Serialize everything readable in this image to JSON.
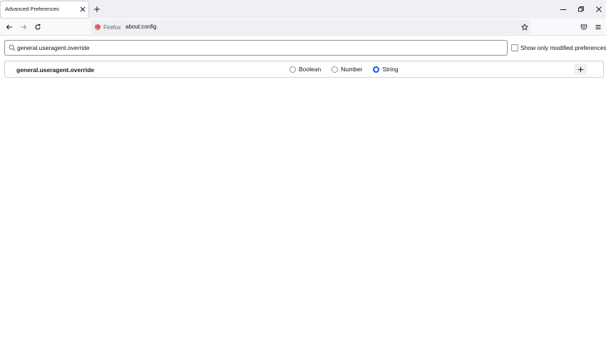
{
  "tabs": [
    {
      "title": "Advanced Preferences",
      "active": true
    }
  ],
  "toolbar": {
    "identity_label": "Firefox",
    "url": "about:config"
  },
  "config": {
    "search_value": "general.useragent.override",
    "show_modified_label": "Show only modified preferences",
    "show_modified_checked": false,
    "new_pref": {
      "name": "general.useragent.override",
      "types": [
        {
          "label": "Boolean",
          "selected": false
        },
        {
          "label": "Number",
          "selected": false
        },
        {
          "label": "String",
          "selected": true
        }
      ],
      "add_glyph": "+"
    }
  },
  "colors": {
    "accent": "#0061e0",
    "tabstrip_bg": "#f0f0f4",
    "navbar_bg": "#f9f9fb",
    "firefox_orange": "#ff7139"
  },
  "icons": [
    "close-icon",
    "plus-icon",
    "minimize-icon",
    "restore-icon",
    "close-window-icon",
    "back-arrow-icon",
    "forward-arrow-icon",
    "reload-icon",
    "firefox-logo-icon",
    "star-icon",
    "pocket-icon",
    "menu-icon",
    "search-icon"
  ]
}
